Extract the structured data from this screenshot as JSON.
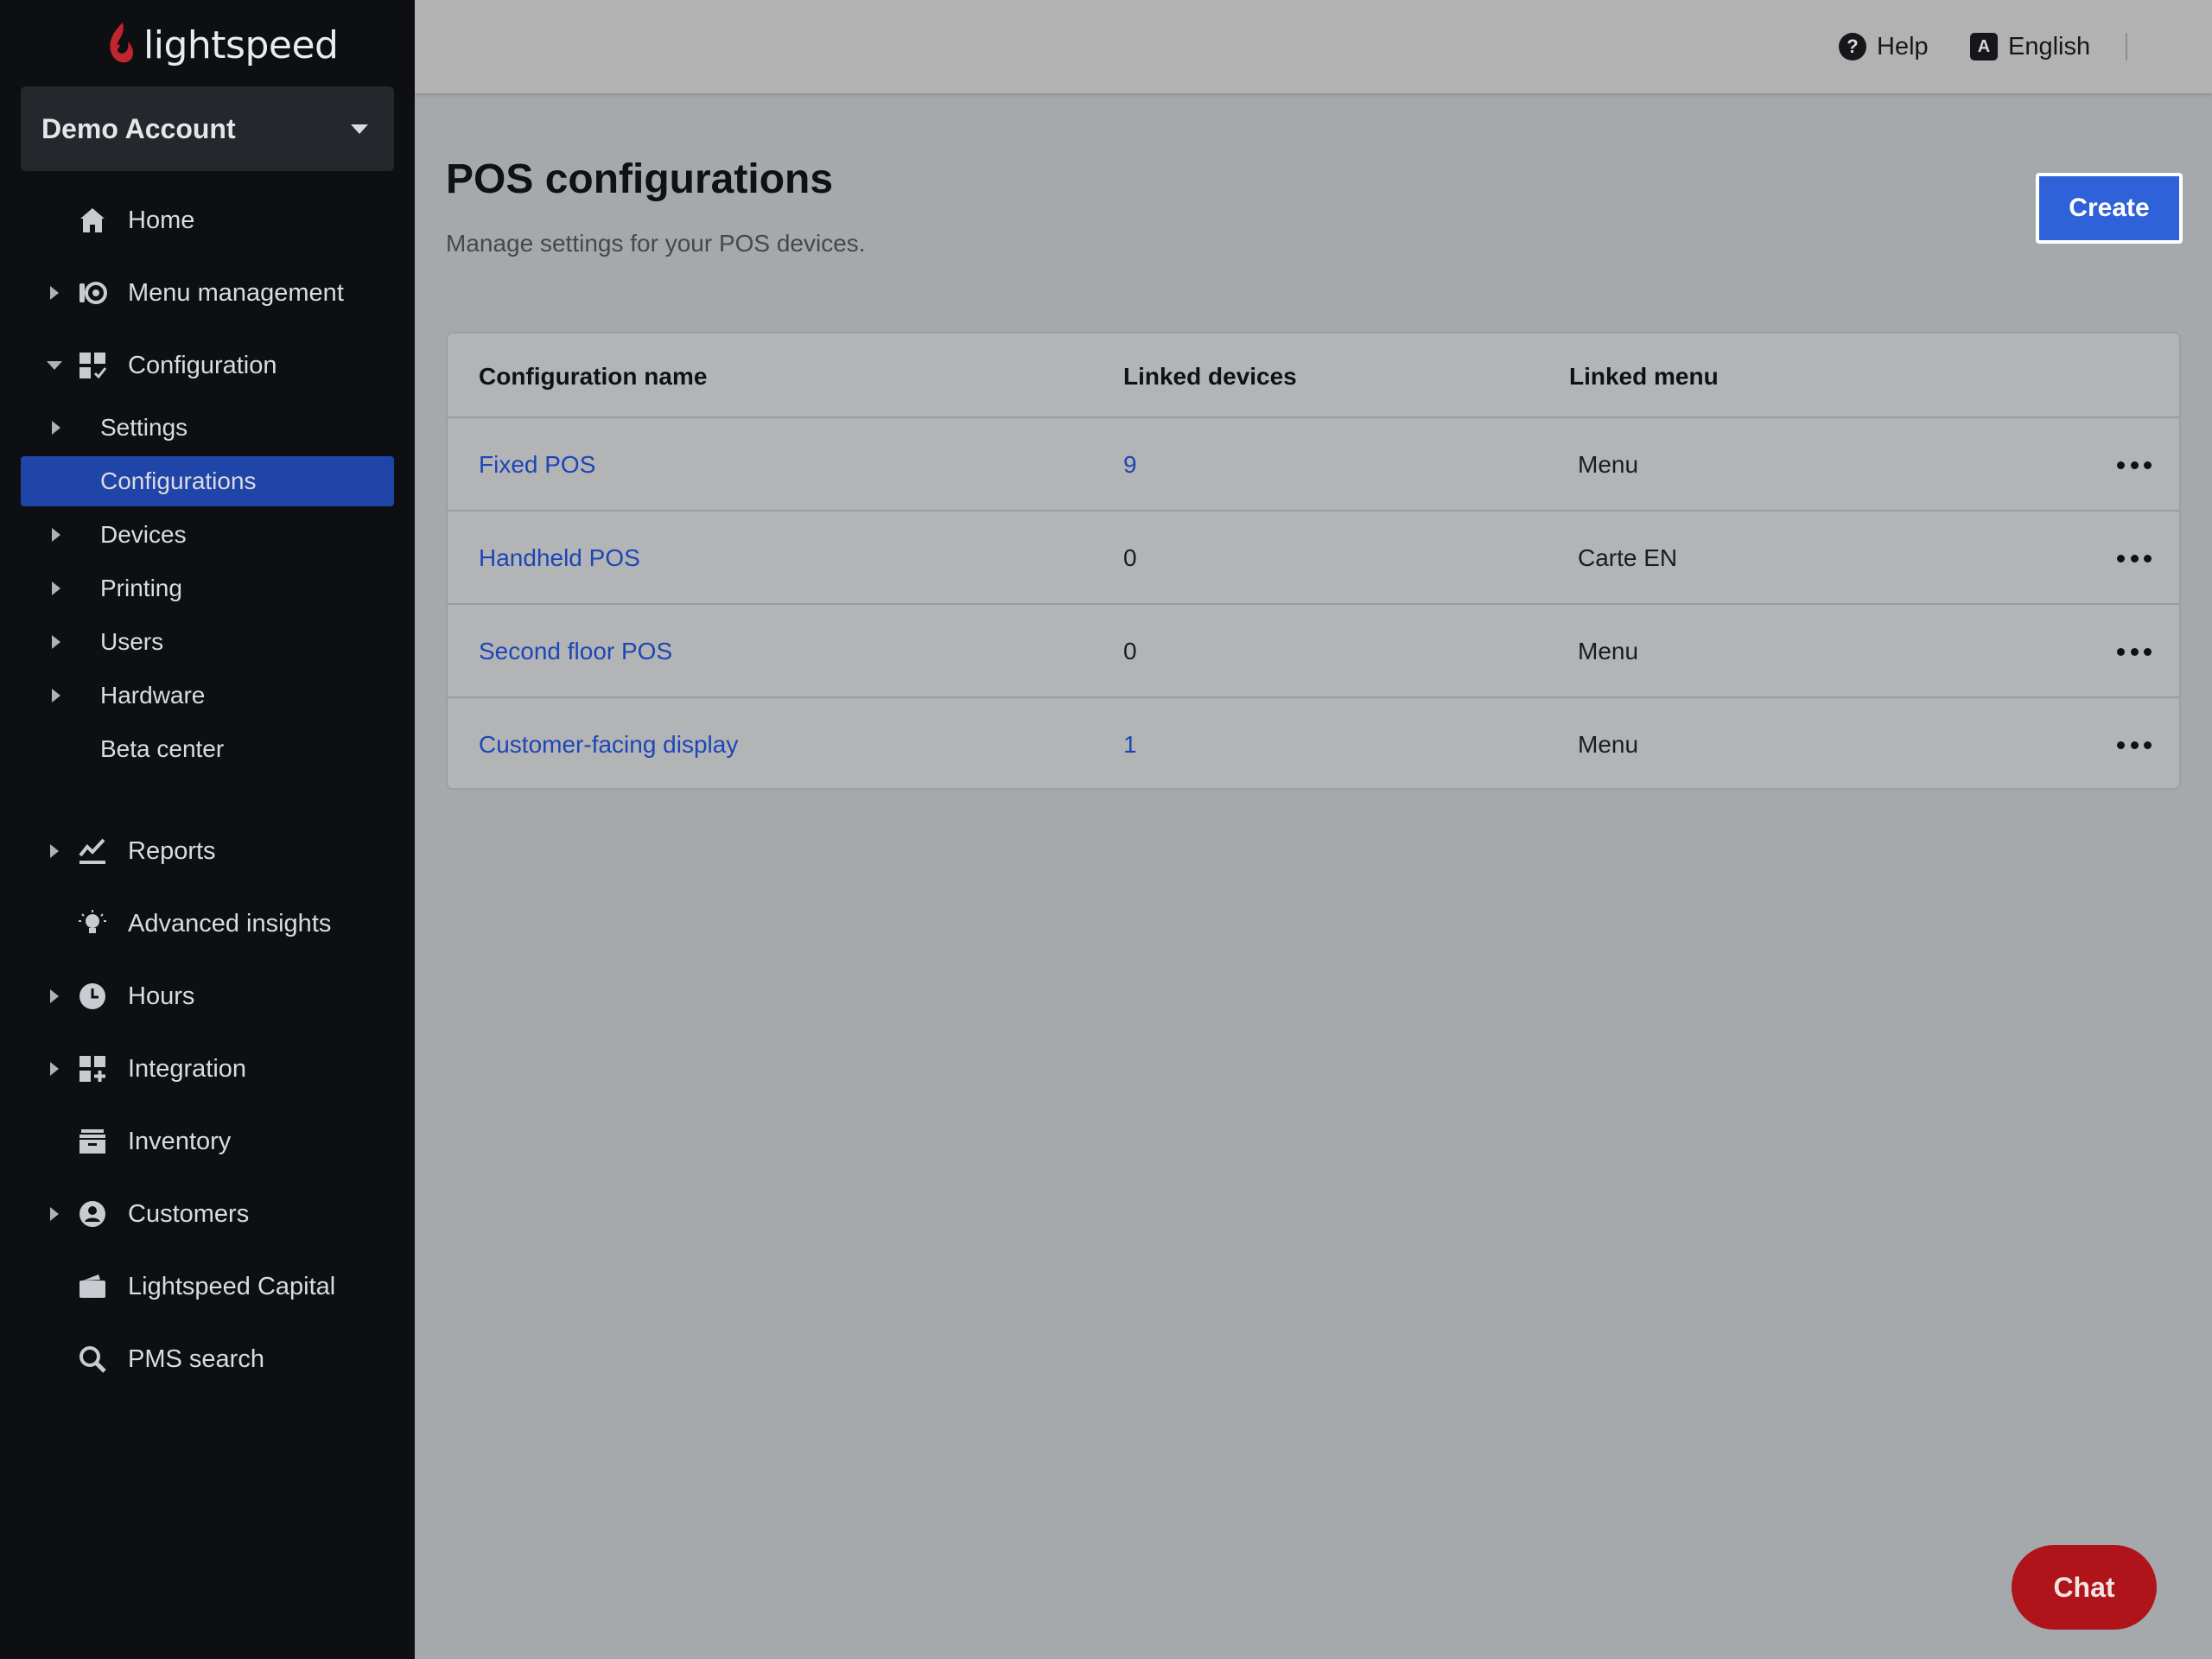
{
  "brand": {
    "logo_text": "lightspeed",
    "accent": "#c0262d"
  },
  "account": {
    "name": "Demo Account"
  },
  "sidebar": {
    "items": [
      {
        "label": "Home",
        "icon": "home-icon"
      },
      {
        "label": "Menu management",
        "icon": "menu-management-icon"
      },
      {
        "label": "Configuration",
        "icon": "configuration-icon"
      },
      {
        "label": "Reports",
        "icon": "reports-icon"
      },
      {
        "label": "Advanced insights",
        "icon": "lightbulb-icon"
      },
      {
        "label": "Hours",
        "icon": "clock-icon"
      },
      {
        "label": "Integration",
        "icon": "integration-icon"
      },
      {
        "label": "Inventory",
        "icon": "inventory-icon"
      },
      {
        "label": "Customers",
        "icon": "customer-icon"
      },
      {
        "label": "Lightspeed Capital",
        "icon": "wallet-icon"
      },
      {
        "label": "PMS search",
        "icon": "search-icon"
      }
    ],
    "config_sub": [
      {
        "label": "Settings"
      },
      {
        "label": "Configurations"
      },
      {
        "label": "Devices"
      },
      {
        "label": "Printing"
      },
      {
        "label": "Users"
      },
      {
        "label": "Hardware"
      },
      {
        "label": "Beta center"
      }
    ],
    "active_color": "#1f45a8"
  },
  "header": {
    "help_label": "Help",
    "help_glyph": "?",
    "language_label": "English",
    "language_glyph": "A"
  },
  "main": {
    "title": "POS configurations",
    "subtitle": "Manage settings for your POS devices.",
    "create_label": "Create",
    "table": {
      "columns": [
        "Configuration name",
        "Linked devices",
        "Linked menu"
      ],
      "rows": [
        {
          "name": "Fixed POS",
          "devices": "9",
          "menu": "Menu"
        },
        {
          "name": "Handheld POS",
          "devices": "0",
          "menu": "Carte EN"
        },
        {
          "name": "Second floor POS",
          "devices": "0",
          "menu": "Menu"
        },
        {
          "name": "Customer-facing display",
          "devices": "1",
          "menu": "Menu"
        }
      ]
    }
  },
  "chat": {
    "label": "Chat",
    "color": "#b0141b"
  }
}
